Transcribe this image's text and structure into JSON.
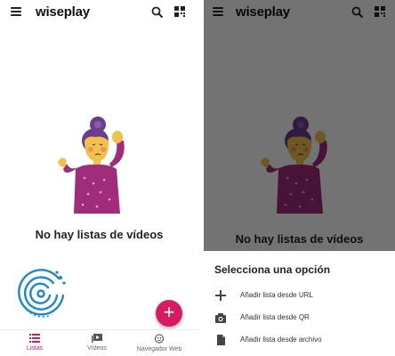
{
  "app": {
    "title": "wiseplay"
  },
  "empty_state": {
    "message": "No hay listas de vídeos"
  },
  "bottom_nav": {
    "items": [
      {
        "label": "Listas",
        "icon": "list-icon",
        "active": true
      },
      {
        "label": "Vídeos",
        "icon": "video-library-icon",
        "active": false
      },
      {
        "label": "Navegador Web",
        "icon": "globe-icon",
        "active": false
      }
    ]
  },
  "fab": {
    "label": "+",
    "icon": "plus-icon"
  },
  "sheet": {
    "title": "Selecciona una opción",
    "options": [
      {
        "label": "Añadir lista desde URL",
        "icon": "plus-icon"
      },
      {
        "label": "Añadir lista desde QR",
        "icon": "camera-icon"
      },
      {
        "label": "Añadir lista desde archivo",
        "icon": "file-icon"
      }
    ]
  },
  "colors": {
    "accent": "#d81b60",
    "scrim": "#4a4a4a",
    "sweater": "#a02c7c",
    "hair": "#6a3d8f"
  }
}
